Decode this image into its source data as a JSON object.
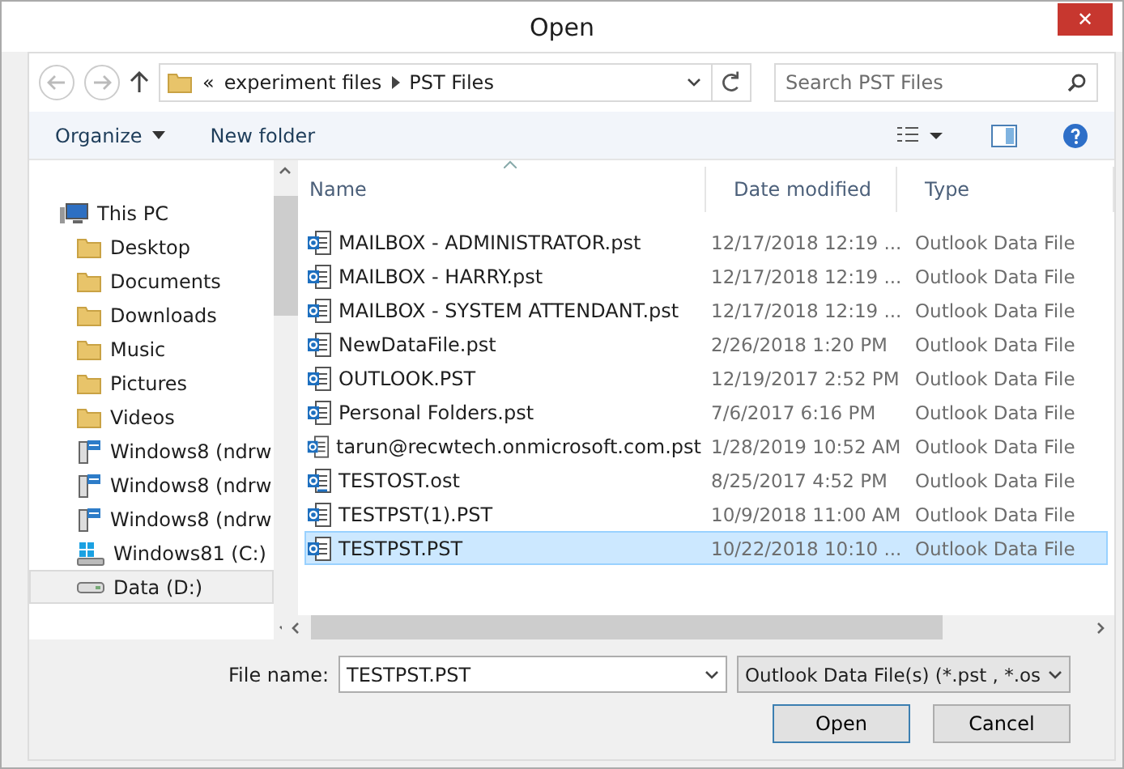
{
  "window": {
    "title": "Open",
    "close": "✕"
  },
  "address": {
    "overflow": "«",
    "path": [
      "experiment files",
      "PST Files"
    ]
  },
  "search": {
    "placeholder": "Search PST Files"
  },
  "toolbar": {
    "organize": "Organize",
    "new_folder": "New folder"
  },
  "nav": [
    {
      "label": "This PC",
      "kind": "computer",
      "selected": false,
      "children": [
        {
          "label": "Desktop",
          "kind": "folder",
          "selected": false
        },
        {
          "label": "Documents",
          "kind": "folder",
          "selected": false
        },
        {
          "label": "Downloads",
          "kind": "folder",
          "selected": false
        },
        {
          "label": "Music",
          "kind": "folder",
          "selected": false
        },
        {
          "label": "Pictures",
          "kind": "folder",
          "selected": false
        },
        {
          "label": "Videos",
          "kind": "folder",
          "selected": false
        },
        {
          "label": "Windows8 (ndrw",
          "kind": "network",
          "selected": false
        },
        {
          "label": "Windows8 (ndrw",
          "kind": "network",
          "selected": false
        },
        {
          "label": "Windows8 (ndrw",
          "kind": "network",
          "selected": false
        },
        {
          "label": "Windows81 (C:)",
          "kind": "system",
          "selected": false
        },
        {
          "label": "Data (D:)",
          "kind": "drive",
          "selected": true
        }
      ]
    }
  ],
  "columns": [
    "Name",
    "Date modified",
    "Type"
  ],
  "files": [
    {
      "name": "MAILBOX - ADMINISTRATOR.pst",
      "date": "12/17/2018 12:19 ...",
      "type": "Outlook Data File",
      "kind": "pst",
      "selected": false
    },
    {
      "name": "MAILBOX - HARRY.pst",
      "date": "12/17/2018 12:19 ...",
      "type": "Outlook Data File",
      "kind": "pst",
      "selected": false
    },
    {
      "name": "MAILBOX - SYSTEM ATTENDANT.pst",
      "date": "12/17/2018 12:19 ...",
      "type": "Outlook Data File",
      "kind": "pst",
      "selected": false
    },
    {
      "name": "NewDataFile.pst",
      "date": "2/26/2018 1:20 PM",
      "type": "Outlook Data File",
      "kind": "pst",
      "selected": false
    },
    {
      "name": "OUTLOOK.PST",
      "date": "12/19/2017 2:52 PM",
      "type": "Outlook Data File",
      "kind": "pst",
      "selected": false
    },
    {
      "name": "Personal Folders.pst",
      "date": "7/6/2017 6:16 PM",
      "type": "Outlook Data File",
      "kind": "pst",
      "selected": false
    },
    {
      "name": "tarun@recwtech.onmicrosoft.com.pst",
      "date": "1/28/2019 10:52 AM",
      "type": "Outlook Data File",
      "kind": "pst",
      "selected": false
    },
    {
      "name": "TESTOST.ost",
      "date": "8/25/2017 4:52 PM",
      "type": "Outlook Data File",
      "kind": "ost",
      "selected": false
    },
    {
      "name": "TESTPST(1).PST",
      "date": "10/9/2018 11:00 AM",
      "type": "Outlook Data File",
      "kind": "pst",
      "selected": false
    },
    {
      "name": "TESTPST.PST",
      "date": "10/22/2018 10:10 ...",
      "type": "Outlook Data File",
      "kind": "pst",
      "selected": true
    }
  ],
  "footer": {
    "file_name_label": "File name:",
    "file_name": "TESTPST.PST",
    "filter": "Outlook Data File(s) (*.pst , *.os",
    "open": "Open",
    "cancel": "Cancel"
  }
}
